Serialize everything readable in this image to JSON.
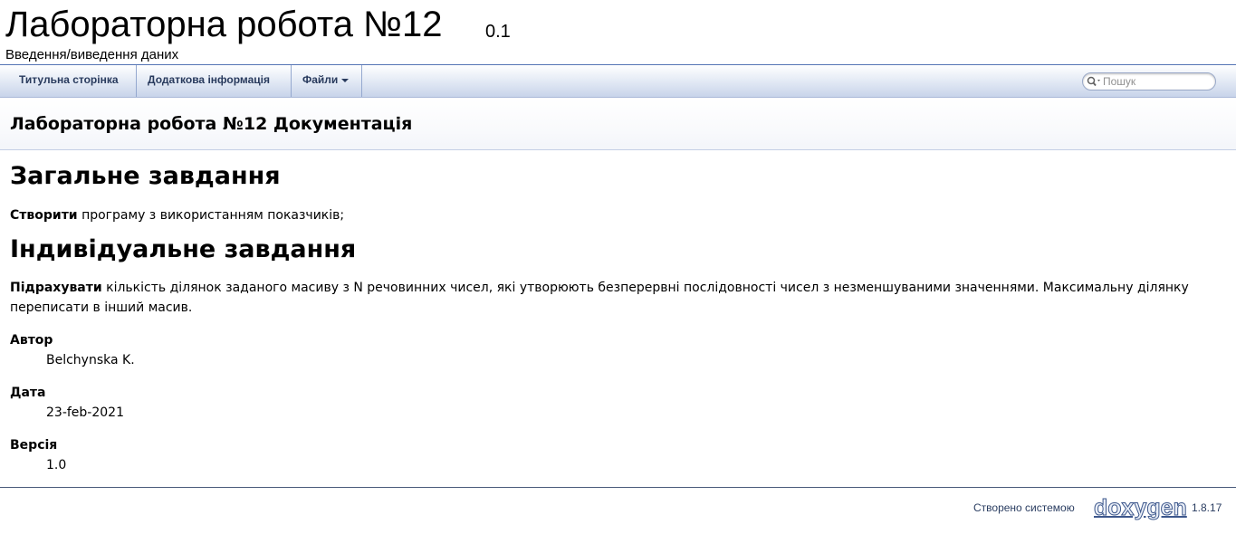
{
  "title_area": {
    "project_name": "Лабораторна робота №12",
    "project_number": "0.1",
    "project_brief": "Введення/виведення даних"
  },
  "navbar": {
    "items": [
      {
        "label": "Титульна сторінка"
      },
      {
        "label": "Додаткова інформація"
      },
      {
        "label": "Файли",
        "has_dropdown": true
      }
    ],
    "search": {
      "placeholder": "Пошук",
      "value": ""
    }
  },
  "header": {
    "title": "Лабораторна робота №12 Документація"
  },
  "content": {
    "general": {
      "heading": "Загальне завдання",
      "bold": "Створити",
      "text": " програму з використанням показчиків;"
    },
    "individual": {
      "heading": "Індивідуальне завдання",
      "bold": "Підрахувати",
      "text": " кількість ділянок заданого масиву з N речовинних чисел, які утворюють безперервні послідовності чисел з незменшуваними значеннями. Максимальну ділянку переписати в інший масив."
    },
    "author": {
      "term": "Автор",
      "value": "Belchynska K."
    },
    "date": {
      "term": "Дата",
      "value": "23-feb-2021"
    },
    "version": {
      "term": "Версія",
      "value": "1.0"
    }
  },
  "footer": {
    "generated_by": "Створено системою",
    "logo_text": "doxygen",
    "version": "1.8.17"
  },
  "colors": {
    "nav_text": "#283A5D",
    "border": "#5373B4",
    "footer_text": "#2A3D61"
  }
}
